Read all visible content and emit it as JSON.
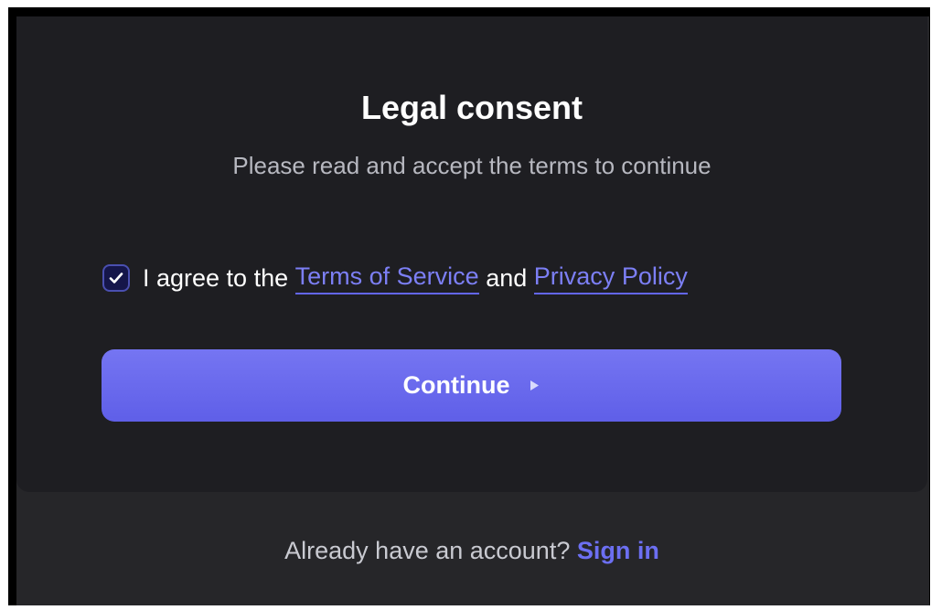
{
  "consent": {
    "title": "Legal consent",
    "subtitle": "Please read and accept the terms to continue",
    "checkbox_checked": true,
    "agree_prefix": "I agree to the",
    "terms_link": "Terms of Service",
    "conjunction": "and",
    "privacy_link": "Privacy Policy"
  },
  "continue_button": {
    "label": "Continue",
    "icon": "play-arrow-icon"
  },
  "footer": {
    "prompt": "Already have an account?",
    "signin_link": "Sign in"
  },
  "colors": {
    "accent": "#6366f1",
    "card_background": "#1e1e22",
    "page_background": "#262629"
  }
}
